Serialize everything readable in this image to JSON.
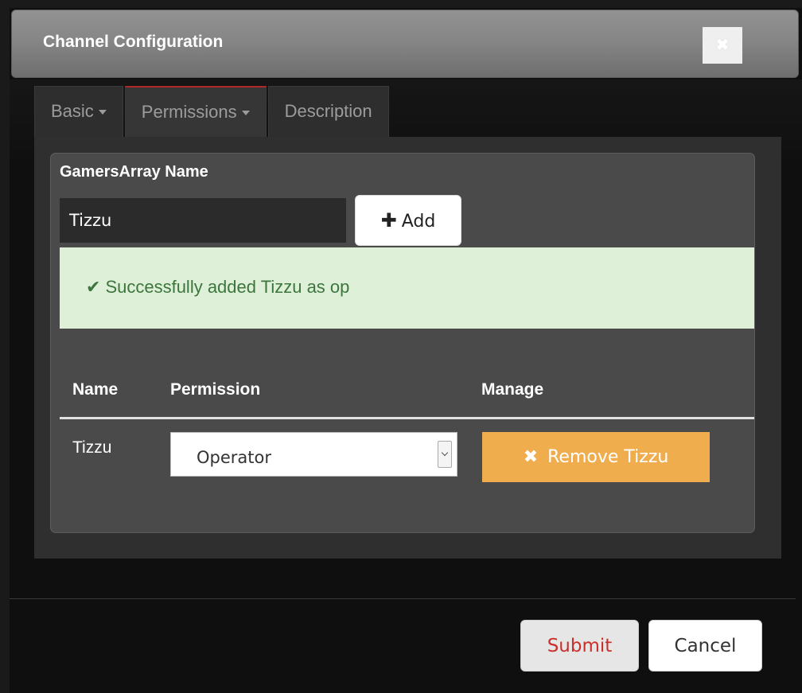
{
  "dialog": {
    "title": "Channel Configuration",
    "close_glyph": "✖"
  },
  "tabs": [
    {
      "label": "Basic",
      "has_caret": true,
      "active": false
    },
    {
      "label": "Permissions",
      "has_caret": true,
      "active": true
    },
    {
      "label": "Description",
      "has_caret": false,
      "active": false
    }
  ],
  "permissions_panel": {
    "name_label": "GamersArray Name",
    "name_input_value": "Tizzu",
    "add_button_label": "Add",
    "add_icon": "plus-icon",
    "alert": {
      "icon": "check-icon",
      "message": "Successfully added Tizzu as op"
    },
    "table": {
      "headers": [
        "Name",
        "Permission",
        "Manage"
      ],
      "rows": [
        {
          "name": "Tizzu",
          "permission": "Operator",
          "manage_label": "Remove Tizzu"
        }
      ]
    }
  },
  "footer": {
    "submit_label": "Submit",
    "cancel_label": "Cancel"
  },
  "colors": {
    "alert_bg": "#dff0d8",
    "alert_text": "#3c763d",
    "warning_button": "#f0ad4e",
    "danger_text": "#c9302c",
    "active_tab_accent": "#b02828"
  }
}
